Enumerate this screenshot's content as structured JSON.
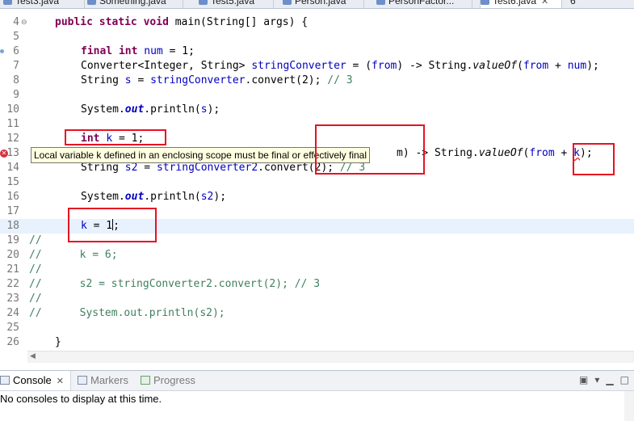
{
  "tabs": [
    {
      "label": "Test3.java",
      "active": false
    },
    {
      "label": "Something.java",
      "active": false
    },
    {
      "label": "Test5.java",
      "active": false
    },
    {
      "label": "Person.java",
      "active": false
    },
    {
      "label": "PersonFactor...",
      "active": false
    },
    {
      "label": "Test6.java",
      "active": true
    },
    {
      "label": "6",
      "active": false
    }
  ],
  "editor": {
    "line_numbers": [
      "4",
      "5",
      "6",
      "7",
      "8",
      "9",
      "10",
      "11",
      "12",
      "13",
      "14",
      "15",
      "16",
      "17",
      "18",
      "19",
      "20",
      "21",
      "22",
      "23",
      "24",
      "25",
      "26"
    ],
    "current_line": "18",
    "error_line": "13",
    "tooltip": "Local variable k defined in an enclosing scope must be final or effectively final",
    "lines": {
      "l4": {
        "kw1": "public",
        "kw2": "static",
        "kw3": "void",
        "rest": " main(String[] args) {"
      },
      "l6": {
        "kw1": "final",
        "kw2": "int",
        "var": "num",
        "rest": " = 1;"
      },
      "l7": {
        "a": "Converter<Integer, String> ",
        "var": "stringConverter",
        "b": " = (",
        "var2": "from",
        "c": ") -> String.",
        "ital": "valueOf",
        "d": "(",
        "var3": "from",
        "e": " + ",
        "var4": "num",
        "f": ");"
      },
      "l8": {
        "a": "String ",
        "var": "s",
        "b": " = ",
        "var2": "stringConverter",
        "c": ".convert(2); ",
        "cmt": "// 3"
      },
      "l10": {
        "a": "System.",
        "fld": "out",
        "b": ".println(",
        "var": "s",
        "c": ");"
      },
      "l12": {
        "kw": "int",
        "var": "k",
        "rest": " = 1;"
      },
      "l13": {
        "a": "m) -> String.",
        "ital": "valueOf",
        "b": "(",
        "var": "from",
        "c": " + ",
        "var2": "k",
        "d": ");"
      },
      "l14": {
        "a": "String ",
        "var": "s2",
        "b": " = ",
        "var2": "stringConverter2",
        "c": ".convert(2); ",
        "cmt": "// 3"
      },
      "l16": {
        "a": "System.",
        "fld": "out",
        "b": ".println(",
        "var": "s2",
        "c": ");"
      },
      "l18": {
        "var": "k",
        "a": " = 1",
        "b": ";"
      },
      "l19": {
        "cmt": "//"
      },
      "l20": {
        "cmt": "//      k = 6;"
      },
      "l21": {
        "cmt": "//"
      },
      "l22": {
        "cmt": "//      s2 = stringConverter2.convert(2); // 3"
      },
      "l23": {
        "cmt": "//"
      },
      "l24": {
        "cmt": "//      System.out.println(s2);"
      },
      "l26": {
        "a": "}"
      }
    }
  },
  "views": {
    "tabs": [
      {
        "label": "Console",
        "active": true
      },
      {
        "label": "Markers",
        "active": false
      },
      {
        "label": "Progress",
        "active": false
      }
    ],
    "console_message": "No consoles to display at this time."
  },
  "icons": [
    "java-file-icon",
    "error-icon",
    "console-icon",
    "markers-icon",
    "progress-icon",
    "close-icon",
    "minimize-icon",
    "maximize-icon",
    "open-console-icon"
  ],
  "colors": {
    "keyword": "#7f0055",
    "variable": "#0000c0",
    "comment": "#3f7f5f",
    "highlight_box": "#e81123",
    "tooltip_bg": "#ffffe1",
    "current_line": "#e8f2fe"
  }
}
